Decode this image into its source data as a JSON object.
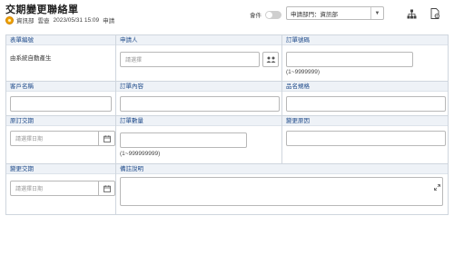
{
  "header": {
    "title": "交期變更聯絡單",
    "user_dept": "資訊部",
    "user_name": "雲壺",
    "date_time": "2023/05/31 15:09",
    "status": "申請"
  },
  "toolbar": {
    "toggle_label": "會件",
    "toggle_on": false,
    "dept_select_value": "申請部門：資訊部",
    "icons": [
      "org-chart-icon",
      "document-settings-icon"
    ]
  },
  "form": {
    "row1": {
      "form_no_label": "表單編號",
      "form_no_value": "由系統自動產生",
      "applicant_label": "申請人",
      "applicant_placeholder": "請選擇",
      "order_no_label": "訂單號碼",
      "order_no_hint": "(1~9999999)"
    },
    "row2": {
      "customer_label": "客戶名稱",
      "order_content_label": "訂單內容",
      "product_spec_label": "品名規格"
    },
    "row3": {
      "orig_delivery_label": "原訂交期",
      "orig_delivery_placeholder": "請選擇日期",
      "order_qty_label": "訂單數量",
      "order_qty_hint": "(1~999999999)",
      "change_reason_label": "變更原因"
    },
    "row4": {
      "new_delivery_label": "變更交期",
      "new_delivery_placeholder": "請選擇日期",
      "remarks_label": "備註說明"
    }
  },
  "colors": {
    "label_text": "#1e4a8a",
    "label_bg": "#eef2f7",
    "border": "#cfd6de",
    "avatar": "#f0a400"
  }
}
